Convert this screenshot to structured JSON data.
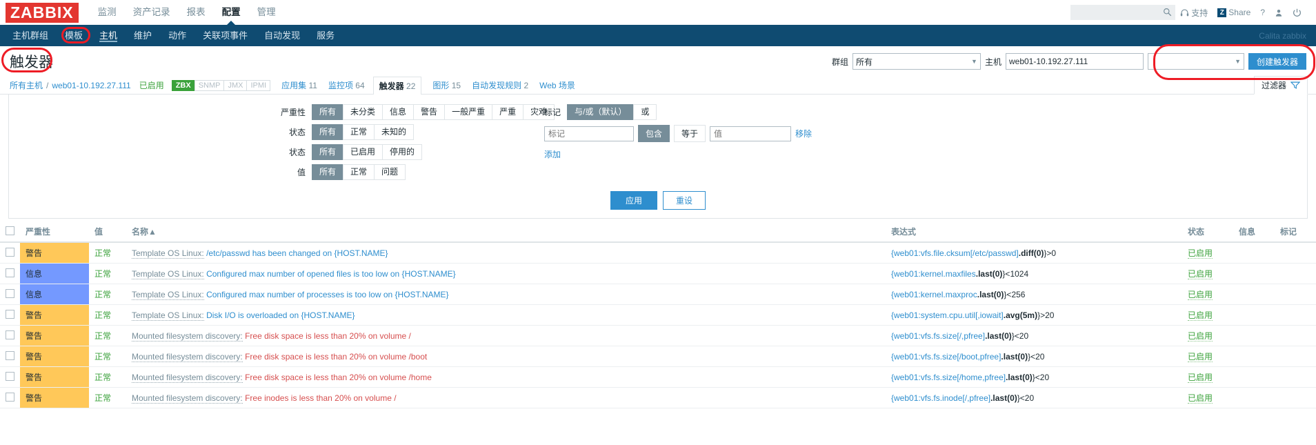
{
  "brand": {
    "logo": "ZABBIX"
  },
  "main_menu": [
    {
      "label": "监测",
      "active": false
    },
    {
      "label": "资产记录",
      "active": false
    },
    {
      "label": "报表",
      "active": false
    },
    {
      "label": "配置",
      "active": true
    },
    {
      "label": "管理",
      "active": false
    }
  ],
  "top_right": {
    "search_placeholder": "",
    "search_value": "",
    "support": "支持",
    "share": "Share",
    "share_badge": "Z",
    "help": "?",
    "user_icon": "user-icon",
    "signout_icon": "power-icon"
  },
  "sub_menu": [
    {
      "label": "主机群组",
      "active": false
    },
    {
      "label": "模板",
      "active": false
    },
    {
      "label": "主机",
      "active": true
    },
    {
      "label": "维护",
      "active": false
    },
    {
      "label": "动作",
      "active": false
    },
    {
      "label": "关联项事件",
      "active": false
    },
    {
      "label": "自动发现",
      "active": false
    },
    {
      "label": "服务",
      "active": false
    }
  ],
  "user_label": "Calita zabbix",
  "page": {
    "title": "触发器",
    "group_label": "群组",
    "group_value": "所有",
    "host_label": "主机",
    "host_value": "web01-10.192.27.111",
    "extra_select_value": "",
    "create_button": "创建触发器"
  },
  "breadcrumb": {
    "all_hosts": "所有主机",
    "separator": "/",
    "host": "web01-10.192.27.111",
    "enabled": "已启用",
    "protocols": [
      {
        "label": "ZBX",
        "on": true
      },
      {
        "label": "SNMP",
        "on": false
      },
      {
        "label": "JMX",
        "on": false
      },
      {
        "label": "IPMI",
        "on": false
      }
    ],
    "tabs": [
      {
        "label": "应用集",
        "count": "11",
        "selected": false
      },
      {
        "label": "监控项",
        "count": "64",
        "selected": false
      },
      {
        "label": "触发器",
        "count": "22",
        "selected": true
      },
      {
        "label": "图形",
        "count": "15",
        "selected": false
      },
      {
        "label": "自动发现规则",
        "count": "2",
        "selected": false
      },
      {
        "label": "Web 场景",
        "count": "",
        "selected": false
      }
    ]
  },
  "filter": {
    "severity_label": "严重性",
    "severity_options": [
      {
        "label": "所有",
        "on": true
      },
      {
        "label": "未分类",
        "on": false
      },
      {
        "label": "信息",
        "on": false
      },
      {
        "label": "警告",
        "on": false
      },
      {
        "label": "一般严重",
        "on": false
      },
      {
        "label": "严重",
        "on": false
      },
      {
        "label": "灾难",
        "on": false
      }
    ],
    "state_label": "状态",
    "state_options": [
      {
        "label": "所有",
        "on": true
      },
      {
        "label": "正常",
        "on": false
      },
      {
        "label": "未知的",
        "on": false
      }
    ],
    "status_label": "状态",
    "status_options": [
      {
        "label": "所有",
        "on": true
      },
      {
        "label": "已启用",
        "on": false
      },
      {
        "label": "停用的",
        "on": false
      }
    ],
    "value_label": "值",
    "value_options": [
      {
        "label": "所有",
        "on": true
      },
      {
        "label": "正常",
        "on": false
      },
      {
        "label": "问题",
        "on": false
      }
    ],
    "tag_label": "标记",
    "tag_and": "与/或（默认）",
    "tag_or": "或",
    "tag_name_placeholder": "标记",
    "tag_contains": "包含",
    "tag_equals": "等于",
    "tag_value_placeholder": "值",
    "tag_remove": "移除",
    "tag_add": "添加",
    "apply": "应用",
    "reset": "重设",
    "filter_tab_label": "过滤器"
  },
  "table": {
    "headers": {
      "checkbox": "",
      "severity": "严重性",
      "value": "值",
      "name": "名称",
      "sort_arrow": "▲",
      "expression": "表达式",
      "status": "状态",
      "info": "信息",
      "tags": "标记"
    },
    "rows": [
      {
        "severity": "警告",
        "severity_class": "sev-warn",
        "value": "正常",
        "name_prefix": "Template OS Linux:",
        "name": "/etc/passwd has been changed on {HOST.NAME}",
        "name_disc": false,
        "expr_link": "{web01:vfs.file.cksum[/etc/passwd]",
        "expr_fn": ".diff(0)",
        "expr_tail": "}>0",
        "status": "已启用",
        "info": "",
        "tags": ""
      },
      {
        "severity": "信息",
        "severity_class": "sev-info",
        "value": "正常",
        "name_prefix": "Template OS Linux:",
        "name": "Configured max number of opened files is too low on {HOST.NAME}",
        "name_disc": false,
        "expr_link": "{web01:kernel.maxfiles",
        "expr_fn": ".last(0)",
        "expr_tail": "}<1024",
        "status": "已启用",
        "info": "",
        "tags": ""
      },
      {
        "severity": "信息",
        "severity_class": "sev-info",
        "value": "正常",
        "name_prefix": "Template OS Linux:",
        "name": "Configured max number of processes is too low on {HOST.NAME}",
        "name_disc": false,
        "expr_link": "{web01:kernel.maxproc",
        "expr_fn": ".last(0)",
        "expr_tail": "}<256",
        "status": "已启用",
        "info": "",
        "tags": ""
      },
      {
        "severity": "警告",
        "severity_class": "sev-warn",
        "value": "正常",
        "name_prefix": "Template OS Linux:",
        "name": "Disk I/O is overloaded on {HOST.NAME}",
        "name_disc": false,
        "expr_link": "{web01:system.cpu.util[,iowait]",
        "expr_fn": ".avg(5m)",
        "expr_tail": "}>20",
        "status": "已启用",
        "info": "",
        "tags": ""
      },
      {
        "severity": "警告",
        "severity_class": "sev-warn",
        "value": "正常",
        "name_prefix": "Mounted filesystem discovery:",
        "name": "Free disk space is less than 20% on volume /",
        "name_disc": true,
        "expr_link": "{web01:vfs.fs.size[/,pfree]",
        "expr_fn": ".last(0)",
        "expr_tail": "}<20",
        "status": "已启用",
        "info": "",
        "tags": ""
      },
      {
        "severity": "警告",
        "severity_class": "sev-warn",
        "value": "正常",
        "name_prefix": "Mounted filesystem discovery:",
        "name": "Free disk space is less than 20% on volume /boot",
        "name_disc": true,
        "expr_link": "{web01:vfs.fs.size[/boot,pfree]",
        "expr_fn": ".last(0)",
        "expr_tail": "}<20",
        "status": "已启用",
        "info": "",
        "tags": ""
      },
      {
        "severity": "警告",
        "severity_class": "sev-warn",
        "value": "正常",
        "name_prefix": "Mounted filesystem discovery:",
        "name": "Free disk space is less than 20% on volume /home",
        "name_disc": true,
        "expr_link": "{web01:vfs.fs.size[/home,pfree]",
        "expr_fn": ".last(0)",
        "expr_tail": "}<20",
        "status": "已启用",
        "info": "",
        "tags": ""
      },
      {
        "severity": "警告",
        "severity_class": "sev-warn",
        "value": "正常",
        "name_prefix": "Mounted filesystem discovery:",
        "name": "Free inodes is less than 20% on volume /",
        "name_disc": true,
        "expr_link": "{web01:vfs.fs.inode[/,pfree]",
        "expr_fn": ".last(0)",
        "expr_tail": "}<20",
        "status": "已启用",
        "info": "",
        "tags": ""
      }
    ]
  },
  "colors": {
    "brand_red": "#e33630",
    "nav_blue": "#0f4b71",
    "link_blue": "#2e8ece",
    "warn": "#ffc859",
    "info": "#7499ff",
    "ok_green": "#3ba23b",
    "annotation_red": "#ee1c25"
  }
}
